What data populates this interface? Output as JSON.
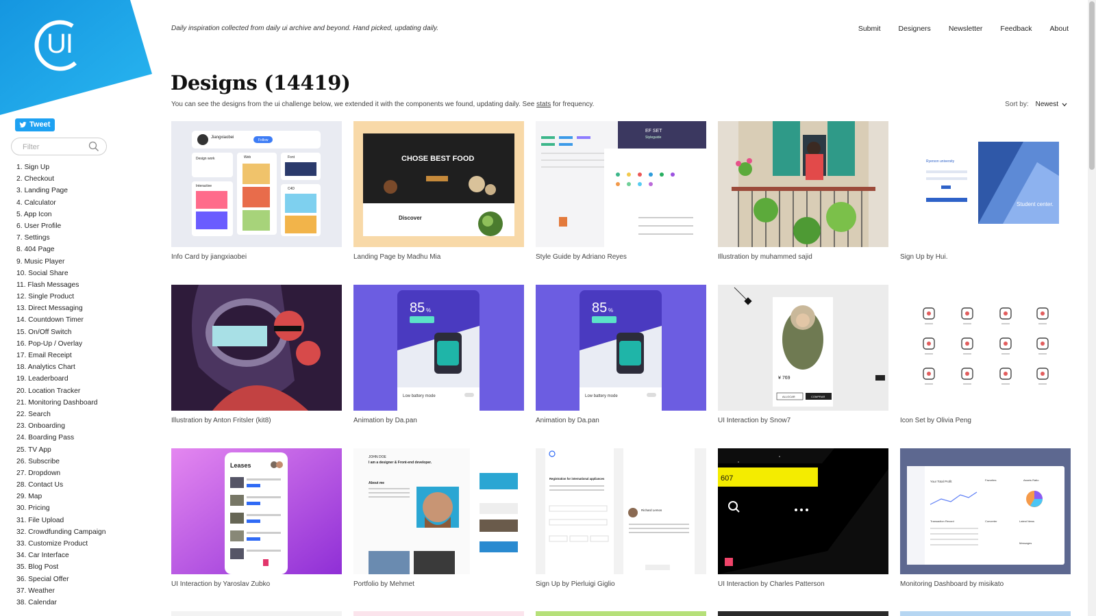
{
  "brand": {
    "logo_text": "UI",
    "logo_color": "#1aa6e8"
  },
  "social": {
    "tweet_label": "Tweet"
  },
  "filter": {
    "placeholder": "Filter"
  },
  "categories": [
    "1. Sign Up",
    "2. Checkout",
    "3. Landing Page",
    "4. Calculator",
    "5. App Icon",
    "6. User Profile",
    "7. Settings",
    "8. 404 Page",
    "9. Music Player",
    "10. Social Share",
    "11. Flash Messages",
    "12. Single Product",
    "13. Direct Messaging",
    "14. Countdown Timer",
    "15. On/Off Switch",
    "16. Pop-Up / Overlay",
    "17. Email Receipt",
    "18. Analytics Chart",
    "19. Leaderboard",
    "20. Location Tracker",
    "21. Monitoring Dashboard",
    "22. Search",
    "23. Onboarding",
    "24. Boarding Pass",
    "25. TV App",
    "26. Subscribe",
    "27. Dropdown",
    "28. Contact Us",
    "29. Map",
    "30. Pricing",
    "31. File Upload",
    "32. Crowdfunding Campaign",
    "33. Customize Product",
    "34. Car Interface",
    "35. Blog Post",
    "36. Special Offer",
    "37. Weather",
    "38. Calendar"
  ],
  "header": {
    "tagline": "Daily inspiration collected from daily ui archive and beyond. Hand picked, updating daily.",
    "nav": [
      "Submit",
      "Designers",
      "Newsletter",
      "Feedback",
      "About"
    ]
  },
  "main": {
    "title": "Designs (14419)",
    "intro_before": "You can see the designs from the ui challenge below, we extended it with the components we found, updating daily. See ",
    "intro_link": "stats",
    "intro_after": " for frequency.",
    "sort_label": "Sort by:",
    "sort_value": "Newest"
  },
  "designs": [
    {
      "caption": "Info Card by jiangxiaobei",
      "thumb_text": [
        "Jiangxiaobei",
        "Follow",
        "Design work",
        "Web",
        "Font",
        "Interactive",
        "C4D"
      ]
    },
    {
      "caption": "Landing Page by Madhu Mia",
      "thumb_text": [
        "CHOSE BEST FOOD",
        "Discover"
      ]
    },
    {
      "caption": "Style Guide by Adriano Reyes",
      "thumb_text": [
        "EF SET",
        "Styleguide"
      ]
    },
    {
      "caption": "Illustration by muhammed sajid",
      "thumb_text": []
    },
    {
      "caption": "Sign Up by Hui.",
      "thumb_text": [
        "Ryerson university",
        "Student center."
      ]
    },
    {
      "caption": "Illustration by Anton Fritsler (kit8)",
      "thumb_text": []
    },
    {
      "caption": "Animation by Da.pan",
      "thumb_text": [
        "85",
        "%",
        "Low battery mode"
      ]
    },
    {
      "caption": "Animation by Da.pan",
      "thumb_text": [
        "85",
        "%",
        "Low battery mode"
      ]
    },
    {
      "caption": "UI Interaction by Snow7",
      "thumb_text": [
        "¥ 769",
        "ALLOCAR",
        "COMPRAR"
      ]
    },
    {
      "caption": "Icon Set by Olivia Peng",
      "thumb_text": []
    },
    {
      "caption": "UI Interaction by Yaroslav Zubko",
      "thumb_text": [
        "Leases"
      ]
    },
    {
      "caption": "Portfolio by Mehmet",
      "thumb_text": [
        "JOHN DOE",
        "I am a designer & Front-end developer.",
        "About me"
      ]
    },
    {
      "caption": "Sign Up by Pierluigi Giglio",
      "thumb_text": [
        "Registration for international appliances",
        "Richard Lemos"
      ]
    },
    {
      "caption": "UI Interaction by Charles Patterson",
      "thumb_text": [
        "607"
      ]
    },
    {
      "caption": "Monitoring Dashboard by misikato",
      "thumb_text": [
        "Your Total Profit",
        "Transaction Record",
        "Assets Ratio",
        "Favorites",
        "Converter",
        "Latest News",
        "Messages"
      ]
    }
  ]
}
